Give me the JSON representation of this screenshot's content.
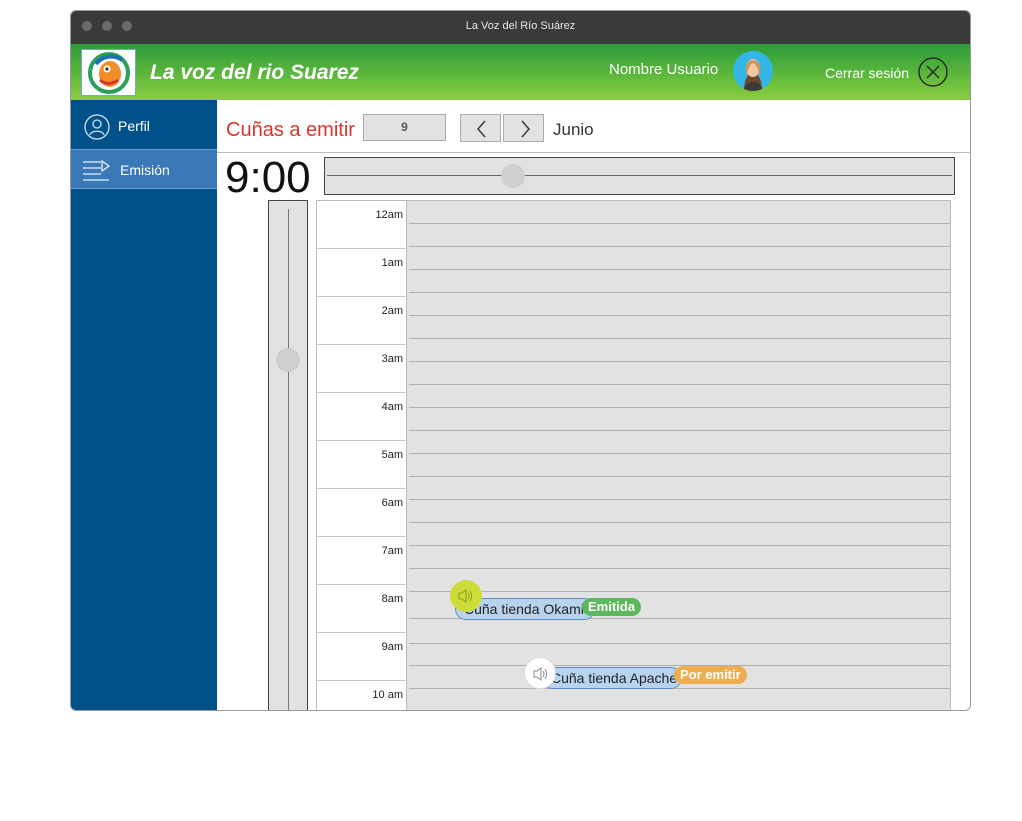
{
  "window": {
    "title": "La Voz del Río Suárez"
  },
  "header": {
    "app_name": "La voz del rio Suarez",
    "user_name": "Nombre Usuario",
    "logout_label": "Cerrar sesión"
  },
  "sidebar": {
    "items": [
      {
        "label": "Perfil",
        "icon": "user-icon"
      },
      {
        "label": "Emisión",
        "icon": "playlist-icon",
        "active": true
      }
    ]
  },
  "toolbar": {
    "title": "Cuñas a emitir",
    "day_value": "9",
    "month": "Junio"
  },
  "time_display": "9:00",
  "calendar": {
    "hours": [
      "12am",
      "1am",
      "2am",
      "3am",
      "4am",
      "5am",
      "6am",
      "7am",
      "8am",
      "9am",
      "10 am"
    ],
    "events": [
      {
        "title": "Cuña tienda Okami",
        "status": "Emitida",
        "status_color": "#5cb85c",
        "audio_icon_color": "#cddc39"
      },
      {
        "title": "Cuña tienda Apache",
        "status": "Por emitir",
        "status_color": "#f0ad4e",
        "audio_icon_color": "#ffffff"
      }
    ]
  },
  "colors": {
    "header_gradient_start": "#2c9a3b",
    "header_gradient_end": "#8ccc42",
    "sidebar": "#00508a",
    "sidebar_active": "#3b78b8",
    "title_red": "#d9362b"
  }
}
